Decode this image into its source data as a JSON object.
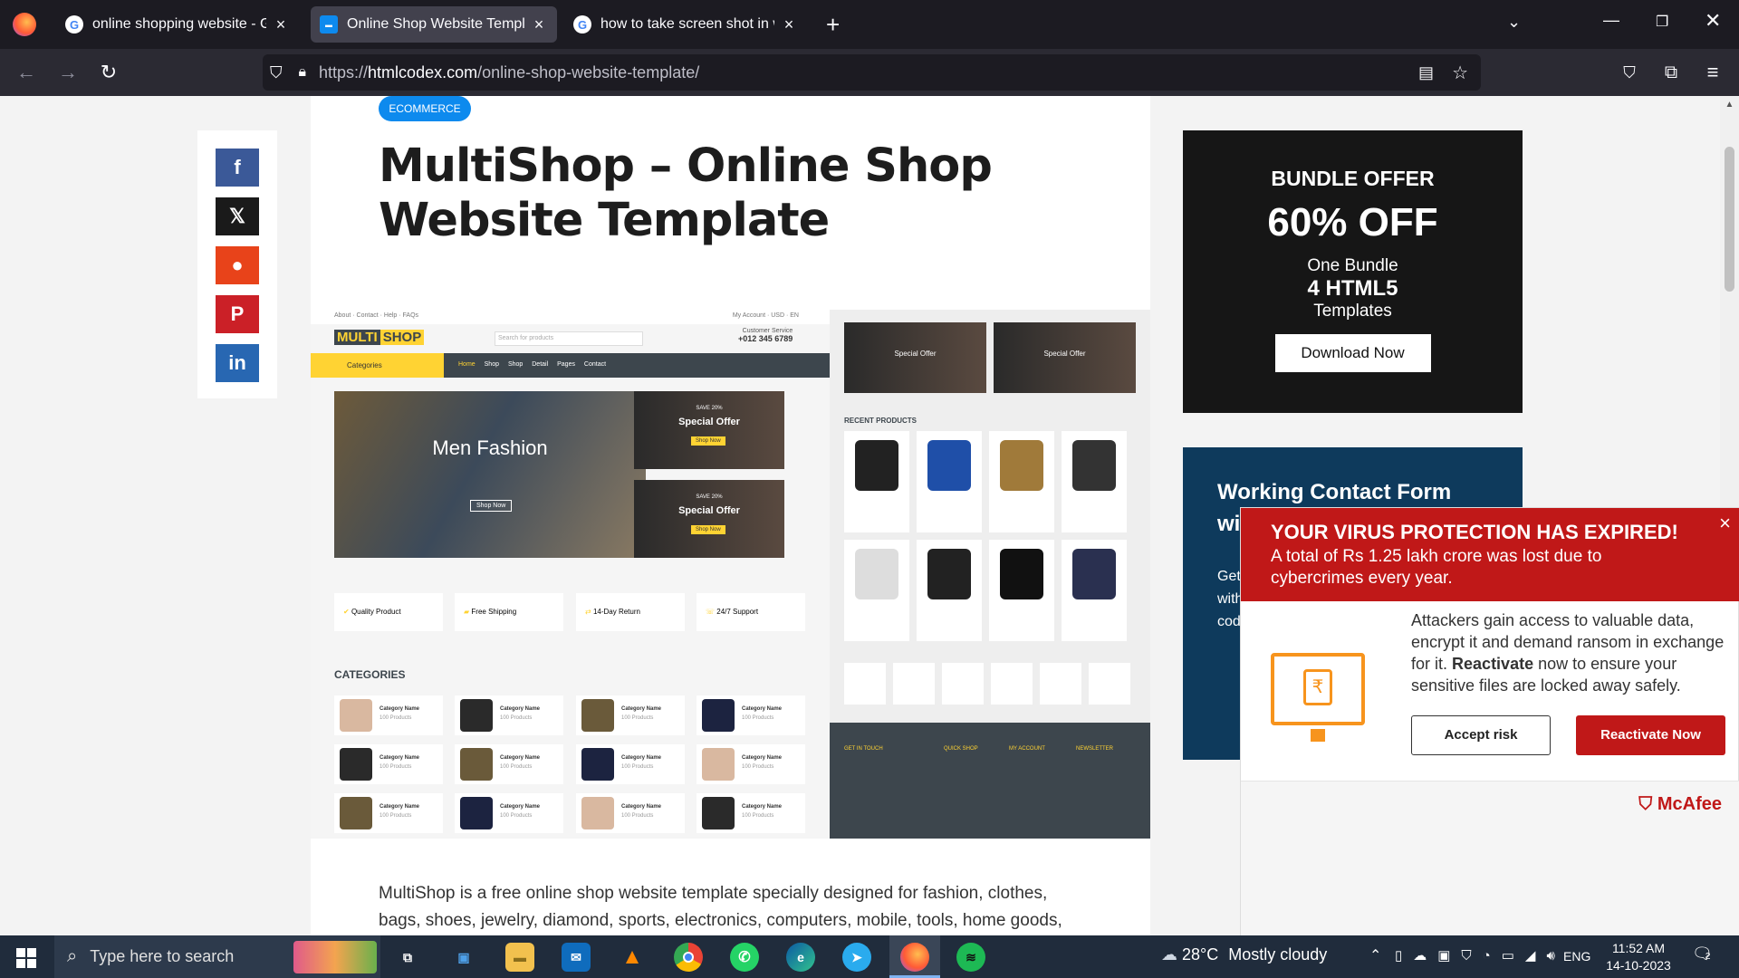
{
  "browser": {
    "tabs": [
      {
        "title": "online shopping website - Google",
        "favicon": "google-icon",
        "active": false
      },
      {
        "title": "Online Shop Website Template",
        "favicon": "htmlcodex-icon",
        "active": true
      },
      {
        "title": "how to take screen shot in windows",
        "favicon": "google-icon",
        "active": false
      }
    ],
    "url_prefix": "https://",
    "url_domain": "htmlcodex.com",
    "url_path": "/online-shop-website-template/"
  },
  "article": {
    "badge": "ECOMMERCE",
    "title": "MultiShop – Online Shop Website Template",
    "description": "MultiShop is a free online shop website template specially designed for fashion, clothes, bags, shoes, jewelry, diamond, sports, electronics, computers, mobile, tools, home goods,"
  },
  "preview": {
    "topbar_links": [
      "About",
      "Contact",
      "Help",
      "FAQs"
    ],
    "topbar_right": [
      "My Account",
      "USD",
      "EN"
    ],
    "logo_a": "MULTI",
    "logo_b": "SHOP",
    "search_placeholder": "Search for products",
    "customer_service": "Customer Service",
    "phone": "+012 345 6789",
    "categories_btn": "Categories",
    "nav": [
      "Home",
      "Shop",
      "Shop Detail",
      "Pages",
      "Contact"
    ],
    "hero_title": "Men Fashion",
    "hero_btn": "Shop Now",
    "offer_save": "SAVE 20%",
    "offer_title": "Special Offer",
    "offer_btn": "Shop Now",
    "features": [
      "Quality Product",
      "Free Shipping",
      "14-Day Return",
      "24/7 Support"
    ],
    "categories_heading": "CATEGORIES",
    "category_name": "Category Name",
    "category_count": "100 Products",
    "recent_heading": "RECENT PRODUCTS",
    "footer_heads": [
      "GET IN TOUCH",
      "QUICK SHOP",
      "MY ACCOUNT",
      "NEWSLETTER"
    ]
  },
  "share": {
    "items": [
      {
        "label": "f",
        "color": "#3b5998"
      },
      {
        "label": "𝕏",
        "color": "#1a1a1a"
      },
      {
        "label": "●",
        "color": "#e8431a"
      },
      {
        "label": "P",
        "color": "#cb2027"
      },
      {
        "label": "in",
        "color": "#2867b2"
      }
    ]
  },
  "ads": {
    "bundle_title": "BUNDLE OFFER",
    "bundle_discount": "60% OFF",
    "bundle_line1": "One Bundle",
    "bundle_line2": "4 HTML5",
    "bundle_line3": "Templates",
    "bundle_btn": "Download Now",
    "form_title": "Working Contact Form with Ajax & PHP",
    "form_text": "Get a functional and working contact form with Ajax & PHP in a few minutes. Just cod"
  },
  "popup": {
    "headline": "YOUR VIRUS PROTECTION HAS EXPIRED!",
    "subline": "A total of Rs 1.25 lakh crore was lost due to cybercrimes every year.",
    "body_a": "Attackers gain access to valuable data, encrypt it and demand ransom in exchange for it.",
    "body_b": "Reactivate",
    "body_c": "now to ensure your sensitive files are locked away safely.",
    "accept_btn": "Accept risk",
    "reactivate_btn": "Reactivate Now",
    "brand": "McAfee",
    "close": "×"
  },
  "taskbar": {
    "search_placeholder": "Type here to search",
    "weather_temp": "28°C",
    "weather_text": "Mostly cloudy",
    "lang": "ENG",
    "time": "11:52 AM",
    "date": "14-10-2023",
    "notif_count": "2"
  },
  "colors": {
    "accent": "#0d8aee",
    "mcafee_red": "#c01818",
    "taskbar": "#202c3c"
  }
}
